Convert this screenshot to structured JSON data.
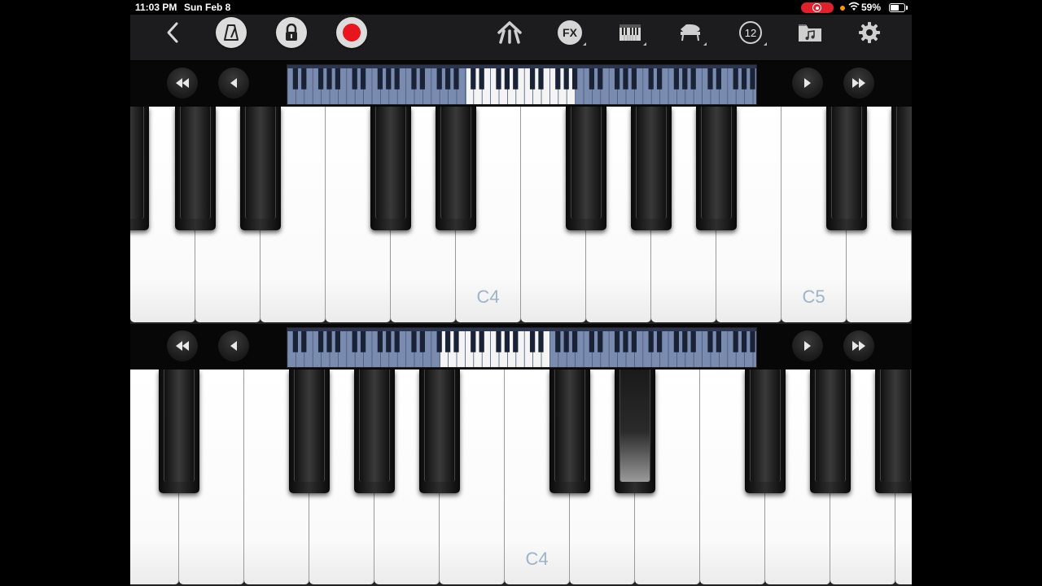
{
  "status": {
    "time": "11:03 PM",
    "date": "Sun Feb 8",
    "battery": "59%"
  },
  "toolbar": {
    "fx_label": "FX",
    "number_badge": "12"
  },
  "keyboards": [
    {
      "label": "C4",
      "label2": "C5"
    },
    {
      "label": "C4"
    }
  ],
  "colors": {
    "record": "#e8141e",
    "note_label": "#9fb3c8",
    "toolbar_bg": "#1c1c1e"
  }
}
